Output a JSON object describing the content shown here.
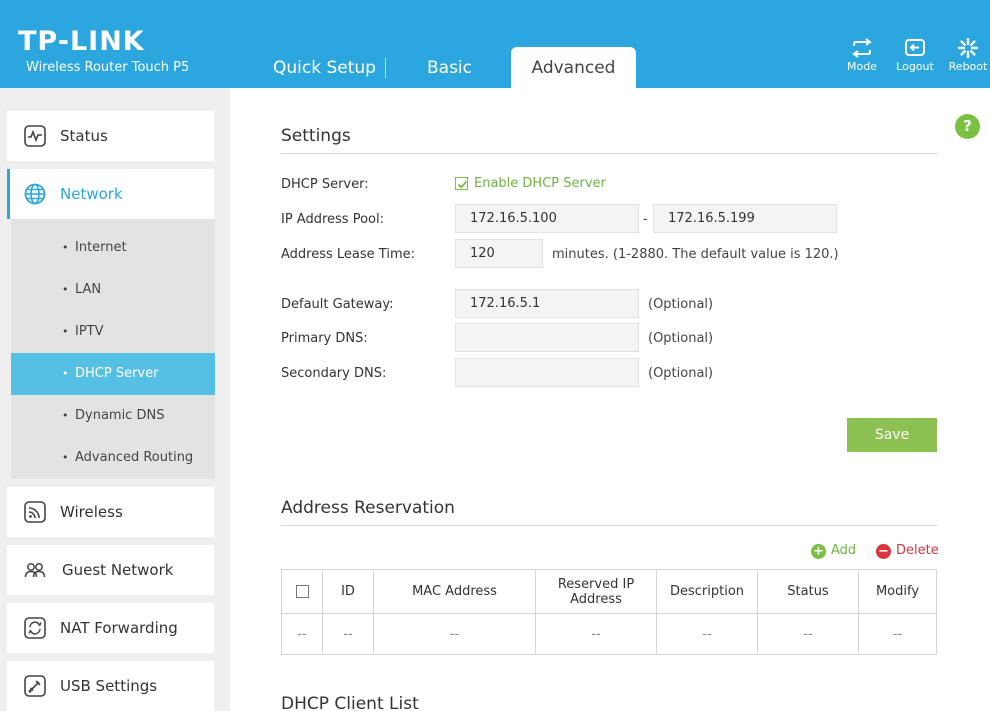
{
  "header": {
    "logo": "TP-LINK",
    "model": "Wireless Router Touch P5",
    "tabs": [
      "Quick Setup",
      "Basic",
      "Advanced"
    ],
    "buttons": {
      "mode": "Mode",
      "logout": "Logout",
      "reboot": "Reboot"
    }
  },
  "sidebar": {
    "items": [
      "Status",
      "Network",
      "Wireless",
      "Guest Network",
      "NAT Forwarding",
      "USB Settings"
    ],
    "network_sub": [
      "Internet",
      "LAN",
      "IPTV",
      "DHCP Server",
      "Dynamic DNS",
      "Advanced Routing"
    ],
    "active_item": "Network",
    "active_sub": "DHCP Server"
  },
  "settings": {
    "title": "Settings",
    "help": "?",
    "dhcp_server_label": "DHCP Server:",
    "enable_dhcp_label": "Enable DHCP Server",
    "enable_dhcp_checked": true,
    "ip_pool_label": "IP Address Pool:",
    "ip_pool_start": "172.16.5.100",
    "ip_pool_dash": "-",
    "ip_pool_end": "172.16.5.199",
    "lease_label": "Address Lease Time:",
    "lease_value": "120",
    "lease_hint": "minutes. (1-2880. The default value is 120.)",
    "gateway_label": "Default Gateway:",
    "gateway_value": "172.16.5.1",
    "primary_dns_label": "Primary DNS:",
    "primary_dns_value": "",
    "secondary_dns_label": "Secondary DNS:",
    "secondary_dns_value": "",
    "optional": "(Optional)",
    "save": "Save"
  },
  "reservation": {
    "title": "Address Reservation",
    "add": "Add",
    "delete": "Delete",
    "columns": [
      "ID",
      "MAC Address",
      "Reserved IP Address",
      "Description",
      "Status",
      "Modify"
    ],
    "row": [
      "--",
      "--",
      "--",
      "--",
      "--",
      "--",
      "--"
    ]
  },
  "client_list": {
    "title": "DHCP Client List"
  },
  "colors": {
    "header": "#2ba6de",
    "active_sub": "#56c0e4",
    "save": "#8cc152",
    "add": "#7ac142",
    "delete": "#d9363e"
  }
}
